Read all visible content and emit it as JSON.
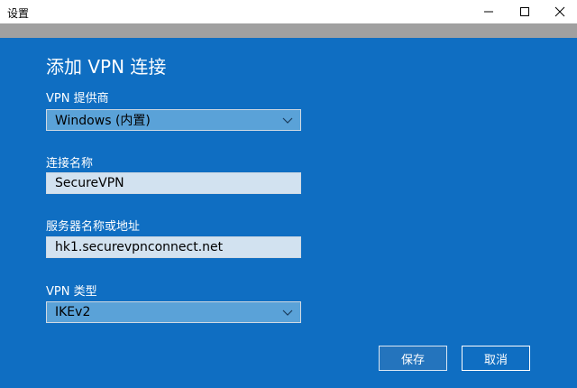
{
  "window": {
    "title": "设置"
  },
  "dialog": {
    "heading": "添加 VPN 连接",
    "provider": {
      "label": "VPN 提供商",
      "value": "Windows (内置)"
    },
    "connection_name": {
      "label": "连接名称",
      "value": "SecureVPN"
    },
    "server": {
      "label": "服务器名称或地址",
      "value": "hk1.securevpnconnect.net"
    },
    "vpn_type": {
      "label": "VPN 类型",
      "value": "IKEv2"
    },
    "save_label": "保存",
    "cancel_label": "取消"
  },
  "colors": {
    "dialog_bg": "#0f6ec2",
    "select_bg": "#5aa2d8",
    "input_bg": "#d2e2f0"
  },
  "icons": {
    "minimize": "minimize-icon",
    "maximize": "maximize-icon",
    "close": "close-icon",
    "dropdown": "chevron-down-icon"
  }
}
